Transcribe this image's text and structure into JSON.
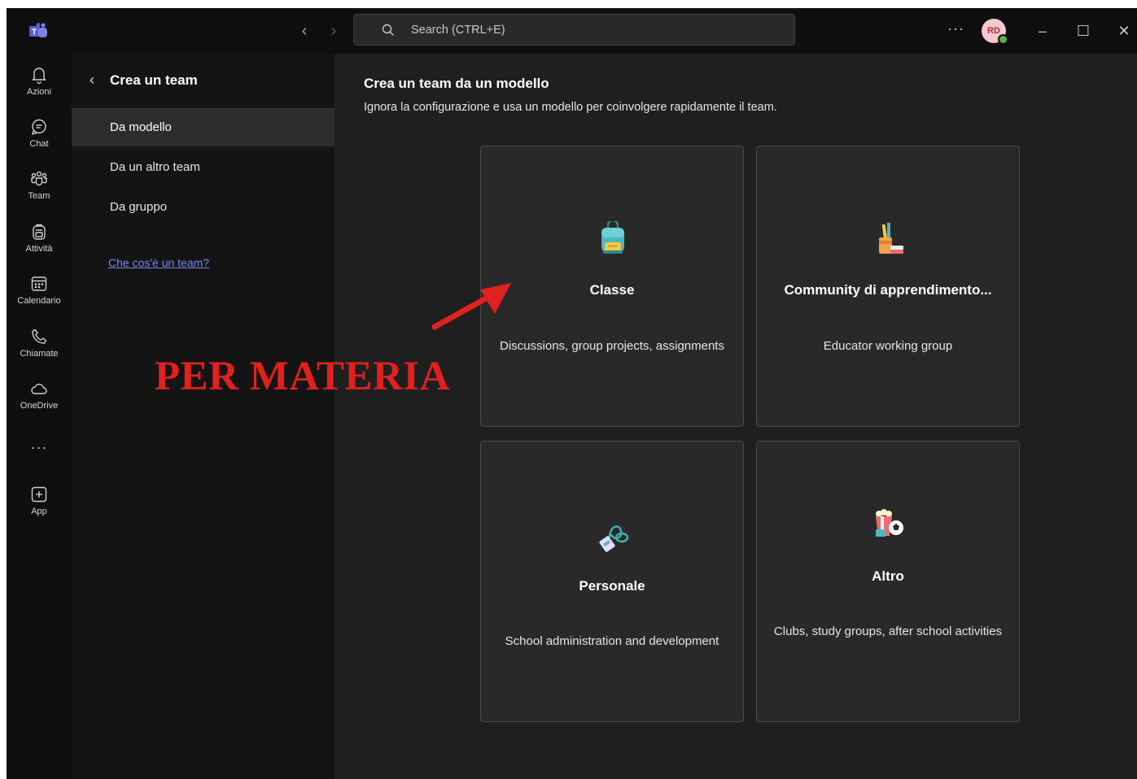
{
  "titlebar": {
    "search_placeholder": "Search (CTRL+E)",
    "more_label": "···",
    "avatar_initials": "RD",
    "presence_color": "#5ab34a"
  },
  "rail": {
    "items": [
      {
        "label": "Azioni",
        "icon": "bell-icon"
      },
      {
        "label": "Chat",
        "icon": "chat-icon"
      },
      {
        "label": "Team",
        "icon": "team-icon"
      },
      {
        "label": "Attività",
        "icon": "backpack-icon"
      },
      {
        "label": "Calendario",
        "icon": "calendar-icon"
      },
      {
        "label": "Chiamate",
        "icon": "phone-icon"
      },
      {
        "label": "OneDrive",
        "icon": "cloud-icon"
      }
    ],
    "more": "···",
    "app_label": "App"
  },
  "panel": {
    "title": "Crea un team",
    "menu": [
      {
        "label": "Da modello",
        "active": true
      },
      {
        "label": "Da un altro team",
        "active": false
      },
      {
        "label": "Da gruppo",
        "active": false
      }
    ],
    "link": "Che cos'è un team?"
  },
  "main": {
    "title": "Crea un team da un modello",
    "subtitle": "Ignora la configurazione e usa un modello per coinvolgere rapidamente il team.",
    "cards": [
      {
        "title": "Classe",
        "desc": "Discussions, group projects, assignments",
        "icon": "backpack-icon"
      },
      {
        "title": "Community di apprendimento...",
        "desc": "Educator working group",
        "icon": "pencil-cup-icon"
      },
      {
        "title": "Personale",
        "desc": "School administration and development",
        "icon": "id-badge-icon"
      },
      {
        "title": "Altro",
        "desc": "Clubs, study groups, after school activities",
        "icon": "popcorn-ball-icon"
      }
    ]
  },
  "annotation": {
    "text": "PER MATERIA",
    "color": "#e0211e"
  },
  "colors": {
    "accent": "#7f85f5",
    "background": "#1f1f1f",
    "card": "#292929"
  }
}
